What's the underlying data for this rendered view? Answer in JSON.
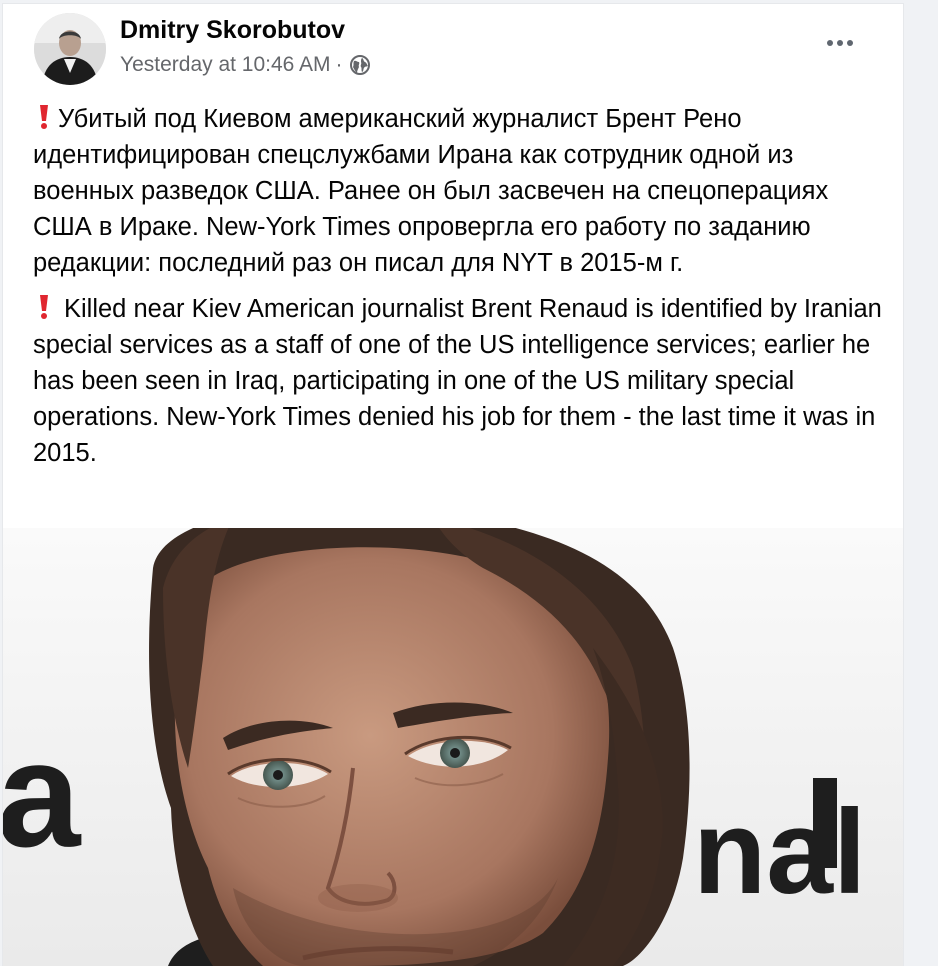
{
  "post": {
    "author": "Dmitry Skorobutov",
    "timestamp": "Yesterday at 10:46 AM",
    "separator": "·",
    "audience_icon": "globe-icon",
    "more_icon": "more-options-icon",
    "text_ru": "Убитый под Киевом американский журналист Брент Рено идентифицирован спецслужбами Ирана как сотрудник одной из военных разведок США. Ранее он был засвечен на спецоперациях США в Ираке. New-York Times опровергла его работу по заданию редакции: последний раз он писал для NYT в 2015-м г.",
    "text_en": "Killed near Kiev American journalist Brent Renaud is identified by Iranian special services as a staff of one of the US intelligence services; earlier he has been seen in Iraq, participating in one of the US military special operations. New-York Times denied his job for them - the last time it was in 2015.",
    "photo_backdrop_letters": [
      "a",
      "nal"
    ]
  },
  "colors": {
    "background": "#f0f2f5",
    "card": "#ffffff",
    "text": "#050505",
    "secondary_text": "#65676b",
    "exclamation": "#e0262f"
  }
}
